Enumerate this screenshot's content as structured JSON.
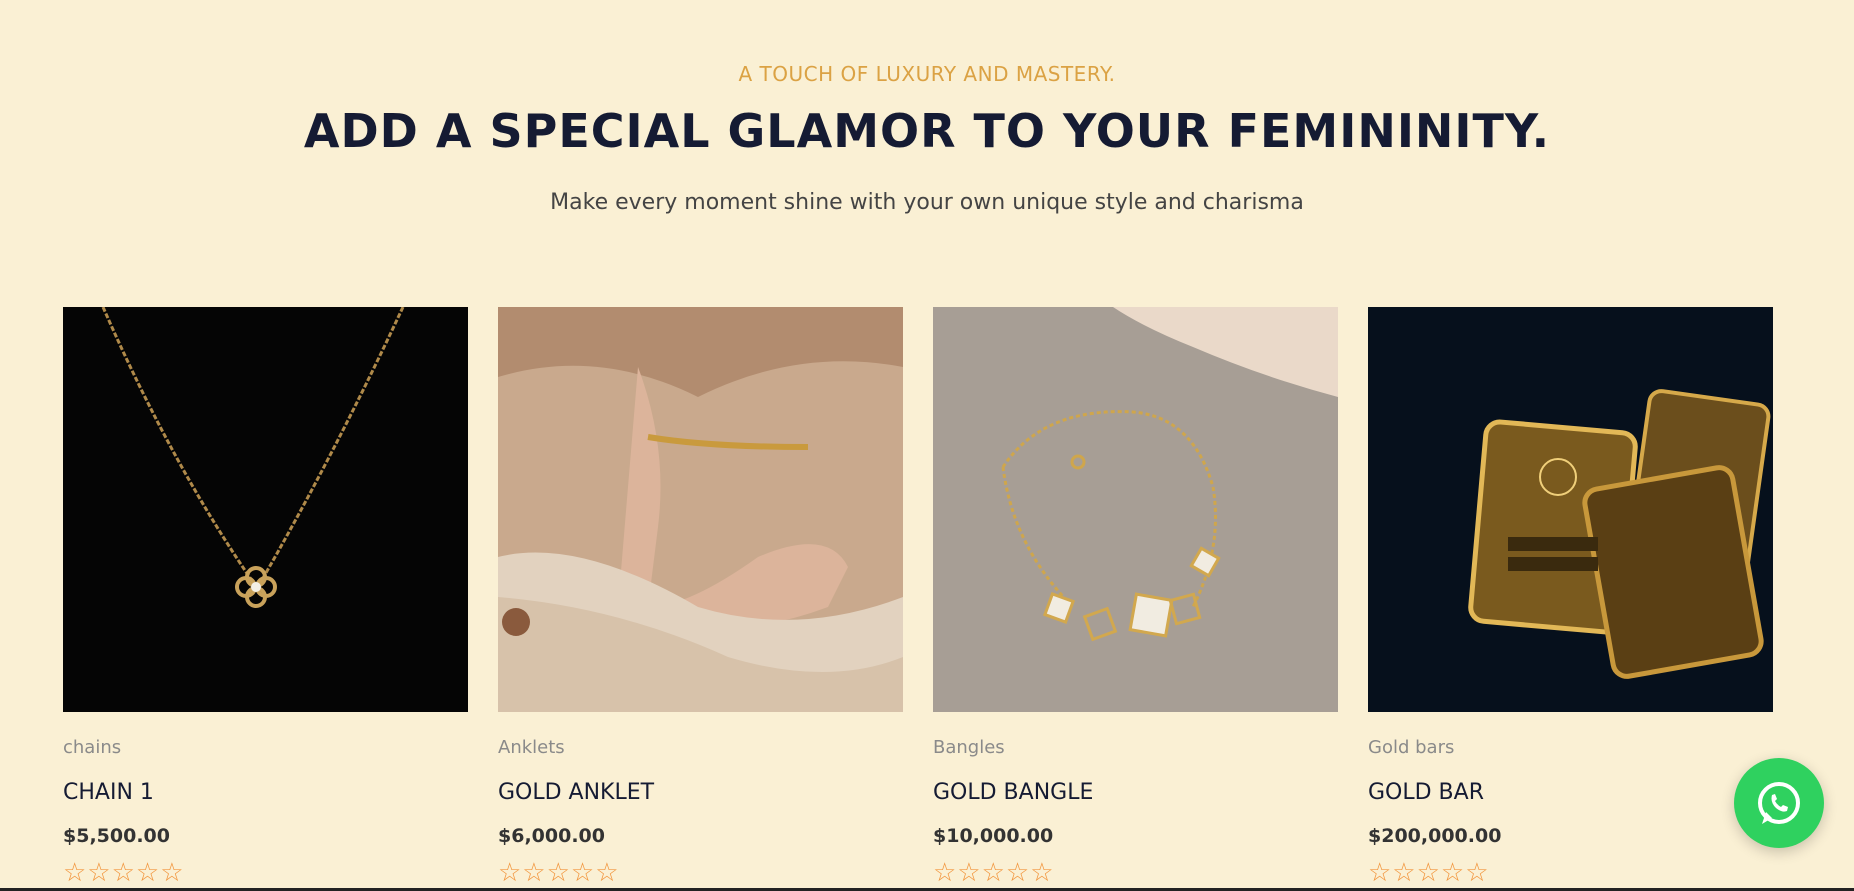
{
  "header": {
    "eyebrow": "A TOUCH OF LUXURY AND MASTERY.",
    "title": "ADD A SPECIAL GLAMOR TO YOUR FEMININITY.",
    "subtitle": "Make every moment shine with your own unique style and charisma"
  },
  "products": [
    {
      "category": "chains",
      "name": "CHAIN 1",
      "price": "$5,500.00",
      "rating": 0,
      "stars": "☆☆☆☆☆",
      "image": "gold-chain-pendant"
    },
    {
      "category": "Anklets",
      "name": "GOLD ANKLET",
      "price": "$6,000.00",
      "rating": 0,
      "stars": "☆☆☆☆☆",
      "image": "gold-anklet"
    },
    {
      "category": "Bangles",
      "name": "GOLD BANGLE",
      "price": "$10,000.00",
      "rating": 0,
      "stars": "☆☆☆☆☆",
      "image": "gold-bracelet"
    },
    {
      "category": "Gold bars",
      "name": "GOLD BAR",
      "price": "$200,000.00",
      "rating": 0,
      "stars": "☆☆☆☆☆",
      "image": "gold-bars"
    }
  ],
  "colors": {
    "background": "#faf0d4",
    "accent": "#dba244",
    "heading": "#151b33",
    "star": "#f2963e",
    "whatsapp": "#2fd15f"
  },
  "floating": {
    "icon": "whatsapp-icon"
  }
}
